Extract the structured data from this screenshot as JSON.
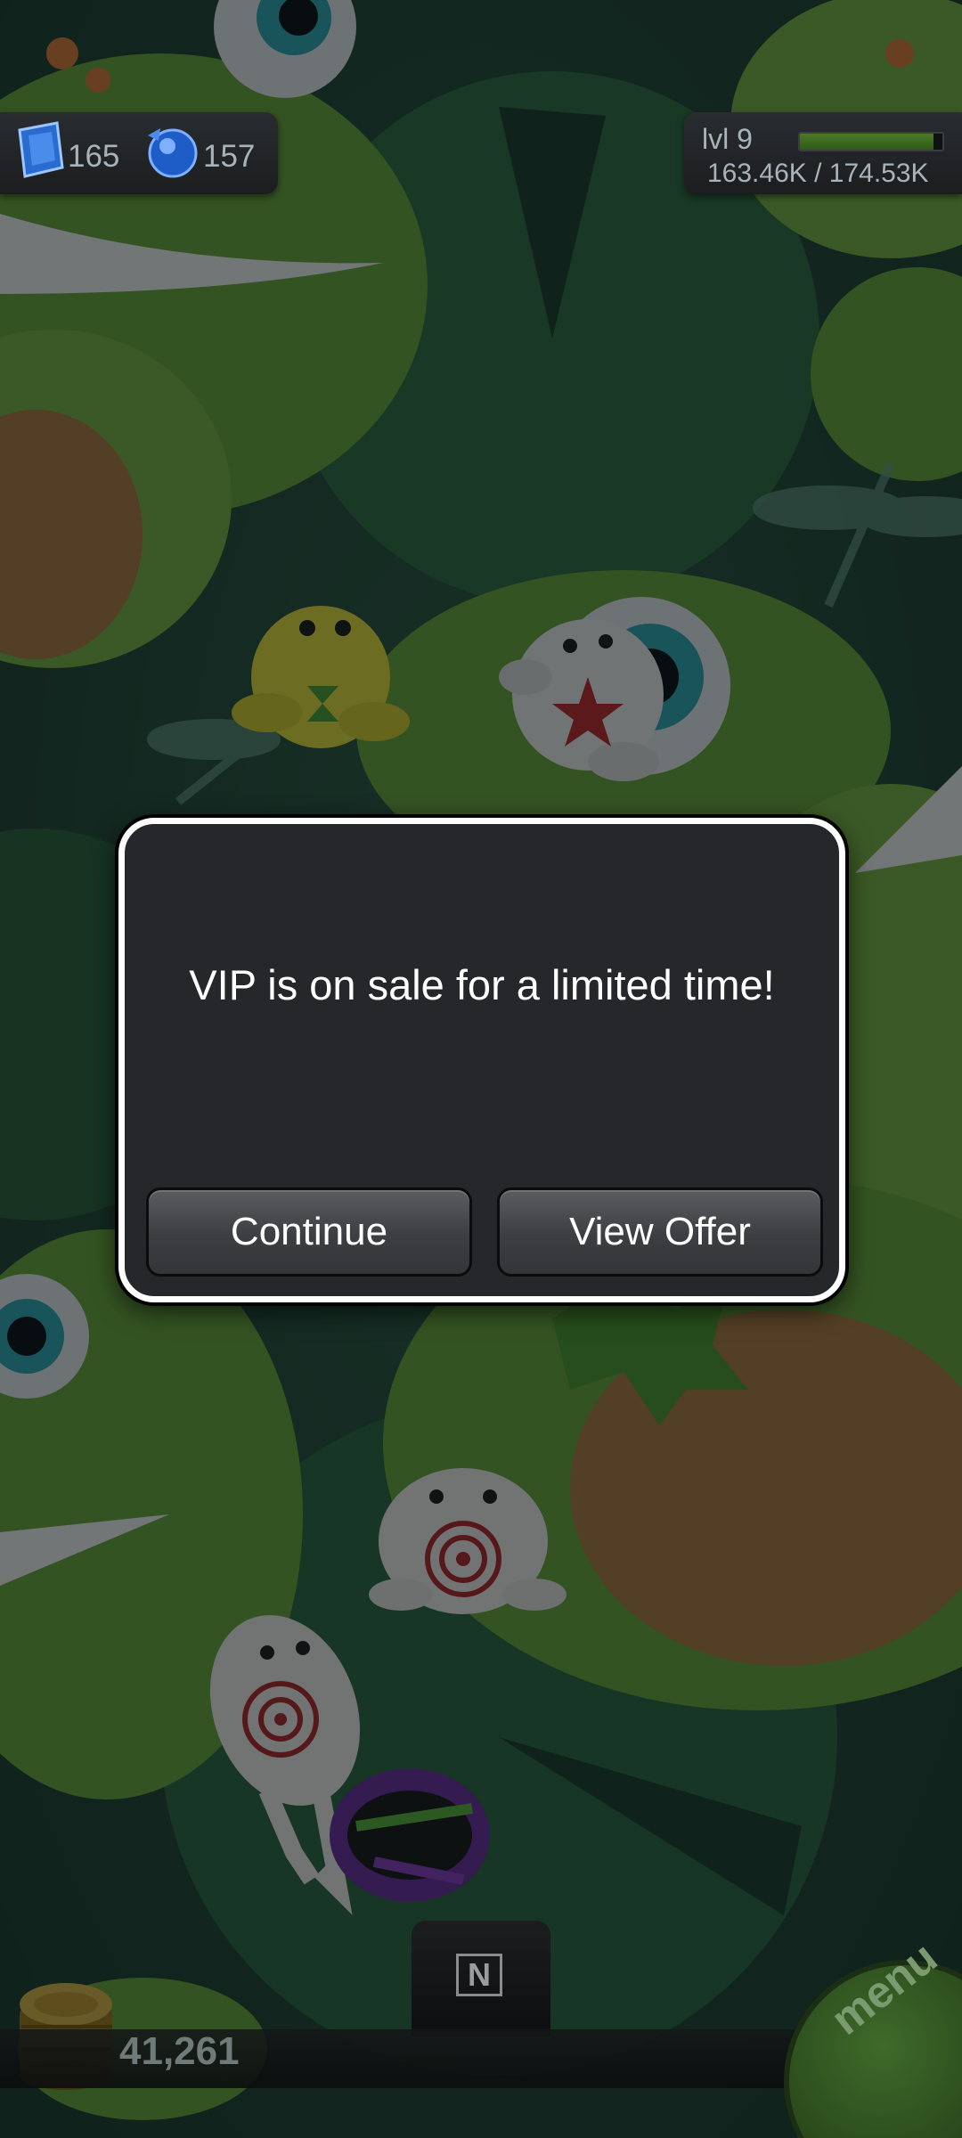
{
  "hud": {
    "gems": "165",
    "orbs": "157",
    "level": "lvl 9",
    "xp_text": "163.46K / 174.53K",
    "xp_fraction": 0.94,
    "gem_icon": "blue-gem-icon",
    "orb_icon": "blue-orb-icon"
  },
  "dialog": {
    "message": "VIP is on sale for a limited time!",
    "continue_label": "Continue",
    "view_offer_label": "View Offer"
  },
  "bottom": {
    "coins": "41,261",
    "n_label": "N",
    "menu_label": "menu",
    "coin_icon": "coin-stack-icon"
  },
  "colors": {
    "accent_green": "#3f6a2a",
    "dialog_bg": "#25272b",
    "dialog_border": "#ffffff",
    "hud_text": "#a8b4ba"
  }
}
